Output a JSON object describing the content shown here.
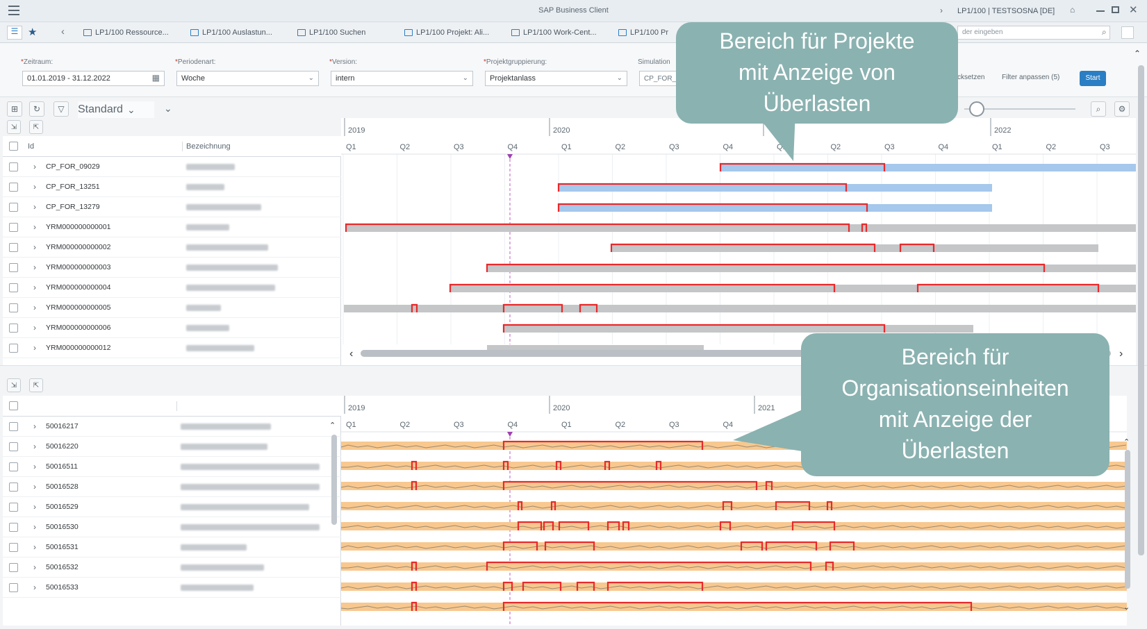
{
  "window": {
    "title": "SAP Business Client",
    "session": "LP1/100 | TESTSOSNA [DE]"
  },
  "tabs": [
    "LP1/100 Ressource...",
    "LP1/100 Auslastun...",
    "LP1/100 Suchen",
    "LP1/100 Projekt: Ali...",
    "LP1/100 Work-Cent...",
    "LP1/100 Pr"
  ],
  "search": {
    "placeholder": "der eingeben"
  },
  "filters": {
    "zeitraum_label": "Zeitraum:",
    "zeitraum_value": "01.01.2019 - 31.12.2022",
    "periodenart_label": "Periodenart:",
    "periodenart_value": "Woche",
    "version_label": "Version:",
    "version_value": "intern",
    "projektgruppierung_label": "Projektgruppierung:",
    "projektgruppierung_value": "Projektanlass",
    "simulation_label": "Simulation",
    "simulation_value": "CP_FOR_",
    "reset_label": "cksetzen",
    "adapt_label": "Filter anpassen (5)",
    "start_label": "Start"
  },
  "toolbar": {
    "variant": "Standard"
  },
  "grid1": {
    "col_id": "Id",
    "col_bez": "Bezeichnung",
    "rows": [
      "CP_FOR_09029",
      "CP_FOR_13251",
      "CP_FOR_13279",
      "YRM000000000001",
      "YRM000000000002",
      "YRM000000000003",
      "YRM000000000004",
      "YRM000000000005",
      "YRM000000000006",
      "YRM000000000012"
    ]
  },
  "grid2": {
    "rows": [
      "50016217",
      "50016220",
      "50016511",
      "50016528",
      "50016529",
      "50016530",
      "50016531",
      "50016532",
      "50016533"
    ]
  },
  "timeline1": {
    "years": [
      "2019",
      "2020",
      "",
      "2022"
    ],
    "quarters": [
      "Q1",
      "Q2",
      "Q3",
      "Q4",
      "Q1",
      "Q2",
      "Q3",
      "Q4",
      "Q1",
      "Q2",
      "Q3",
      "Q4",
      "Q1",
      "Q2",
      "Q3"
    ]
  },
  "timeline2": {
    "years": [
      "2019",
      "2020",
      "2021"
    ],
    "quarters": [
      "Q1",
      "Q2",
      "Q3",
      "Q4",
      "Q1",
      "Q2",
      "Q3",
      "Q4"
    ]
  },
  "callouts": {
    "projects": [
      "Bereich für Projekte",
      "mit Anzeige von",
      "Überlasten"
    ],
    "orgunits": [
      "Bereich für",
      "Organisationseinheiten",
      "mit Anzeige der",
      "Überlasten"
    ]
  },
  "colors": {
    "overload": "#e8292b",
    "project_bar_blue": "#a5c8ec",
    "project_bar_grey": "#c4c6c8",
    "org_bar": "#f8c88f",
    "accent": "#2a7ec4",
    "callout": "#8ab2b0"
  }
}
